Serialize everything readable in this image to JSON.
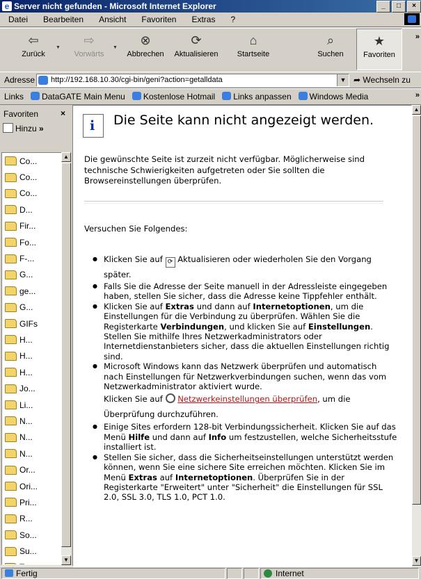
{
  "window": {
    "title": "Server nicht gefunden - Microsoft Internet Explorer"
  },
  "menu": [
    "Datei",
    "Bearbeiten",
    "Ansicht",
    "Favoriten",
    "Extras",
    "?"
  ],
  "toolbar": {
    "back": "Zurück",
    "forward": "Vorwärts",
    "stop": "Abbrechen",
    "refresh": "Aktualisieren",
    "home": "Startseite",
    "search": "Suchen",
    "favorites": "Favoriten"
  },
  "address": {
    "label": "Adresse",
    "url": "http://192.168.10.30/cgi-bin/geni?action=getalldata",
    "go": "Wechseln zu"
  },
  "links": {
    "label": "Links",
    "items": [
      "DataGATE Main Menu",
      "Kostenlose Hotmail",
      "Links anpassen",
      "Windows Media"
    ]
  },
  "favorites_pane": {
    "title": "Favoriten",
    "add": "Hinzu",
    "items": [
      "Co...",
      "Co...",
      "Co...",
      "D...",
      "Fir...",
      "Fo...",
      "F-...",
      "G...",
      "ge...",
      "G...",
      "GIFs",
      "H...",
      "H...",
      "H...",
      "Jo...",
      "Li...",
      "N...",
      "N...",
      "N...",
      "Or...",
      "Ori...",
      "Pri...",
      "R...",
      "So...",
      "Su...",
      "Te...",
      "..."
    ]
  },
  "page": {
    "heading": "Die Seite kann nicht angezeigt werden.",
    "intro": "Die gewünschte Seite ist zurzeit nicht verfügbar. Möglicherweise sind technische Schwierigkeiten aufgetreten oder Sie sollten die Browsereinstellungen überprüfen.",
    "try_label": "Versuchen Sie Folgendes:",
    "b1_pre": "Klicken Sie auf",
    "b1_post": "Aktualisieren oder wiederholen Sie den Vorgang später.",
    "b2": "Falls Sie die Adresse der Seite manuell in der Adressleiste eingegeben haben, stellen Sie sicher, dass die Adresse keine Tippfehler enthält.",
    "b3_1": "Klicken Sie auf",
    "b3_extras": "Extras",
    "b3_2": "und dann auf",
    "b3_inet": "Internetoptionen",
    "b3_3": ", um die Einstellungen für die Verbindung zu überprüfen. Wählen Sie die Registerkarte",
    "b3_verb": "Verbindungen",
    "b3_4": ", und klicken Sie auf",
    "b3_einst": "Einstellungen",
    "b3_5": ". Stellen Sie mithilfe Ihres Netzwerkadministrators oder Internetdienstanbieters sicher, dass die aktuellen Einstellungen richtig sind.",
    "b4_1": "Microsoft Windows kann das Netzwerk überprüfen und automatisch nach Einstellungen für Netzwerkverbindungen suchen, wenn das vom Netzwerkadministrator aktiviert wurde.",
    "b4_2": "Klicken Sie auf",
    "b4_link": "Netzwerkeinstellungen überprüfen",
    "b4_3": ", um die Überprüfung durchzuführen.",
    "b5_1": "Einige Sites erfordern 128-bit Verbindungssicherheit. Klicken Sie auf das Menü",
    "b5_hilfe": "Hilfe",
    "b5_2": "und dann auf",
    "b5_info": "Info",
    "b5_3": "um festzustellen, welche Sicherheitsstufe installiert ist.",
    "b6_1": "Stellen Sie sicher, dass die Sicherheitseinstellungen unterstützt werden können, wenn Sie eine sichere Site erreichen möchten. Klicken Sie im Menü",
    "b6_extras": "Extras",
    "b6_2": "auf",
    "b6_inet": "Internetoptionen",
    "b6_3": ". Überprüfen Sie in der Registerkarte \"Erweitert\" unter \"Sicherheit\" die Einstellungen für SSL 2.0, SSL 3.0, TLS 1.0, PCT 1.0."
  },
  "status": {
    "text": "Fertig",
    "zone": "Internet"
  }
}
